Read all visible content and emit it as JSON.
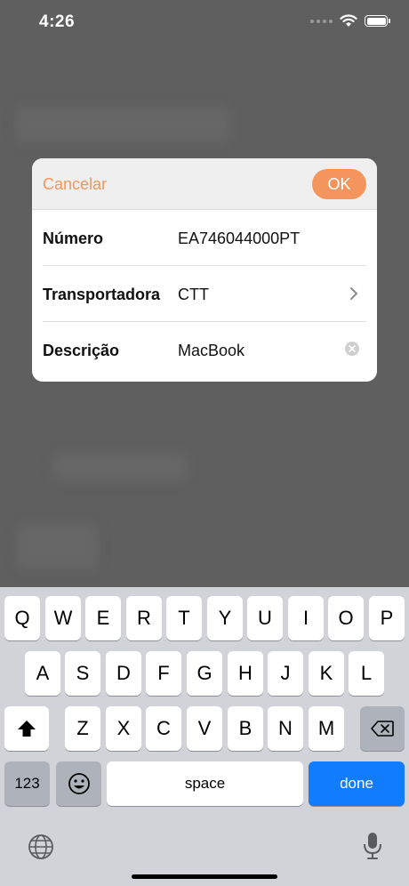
{
  "status_bar": {
    "time": "4:26"
  },
  "dialog": {
    "cancel_label": "Cancelar",
    "ok_label": "OK",
    "fields": [
      {
        "label": "Número",
        "value": "EA746044000PT"
      },
      {
        "label": "Transportadora",
        "value": "CTT"
      },
      {
        "label": "Descrição",
        "value": "MacBook"
      }
    ]
  },
  "keyboard": {
    "row1": [
      "Q",
      "W",
      "E",
      "R",
      "T",
      "Y",
      "U",
      "I",
      "O",
      "P"
    ],
    "row2": [
      "A",
      "S",
      "D",
      "F",
      "G",
      "H",
      "J",
      "K",
      "L"
    ],
    "row3": [
      "Z",
      "X",
      "C",
      "V",
      "B",
      "N",
      "M"
    ],
    "numbers_label": "123",
    "space_label": "space",
    "done_label": "done"
  },
  "colors": {
    "accent": "#f3955c",
    "done_key": "#127cff"
  },
  "icons": [
    "wifi-icon",
    "battery-icon",
    "chevron-right-icon",
    "clear-icon",
    "shift-icon",
    "backspace-icon",
    "emoji-icon",
    "globe-icon",
    "microphone-icon"
  ]
}
